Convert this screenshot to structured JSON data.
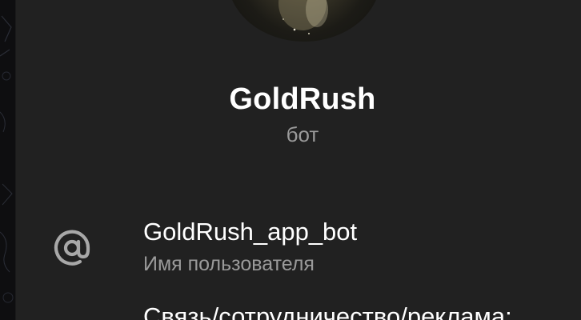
{
  "profile": {
    "name": "GoldRush",
    "status": "бот"
  },
  "username_row": {
    "value": "GoldRush_app_bot",
    "label": "Имя пользователя",
    "icon": "at-icon"
  },
  "description": {
    "text": "Связь/сотрудничество/реклама:"
  },
  "colors": {
    "background": "#212121",
    "primary_text": "#ffffff",
    "secondary_text": "#9a9a9a",
    "icon": "#a8a8a8"
  }
}
